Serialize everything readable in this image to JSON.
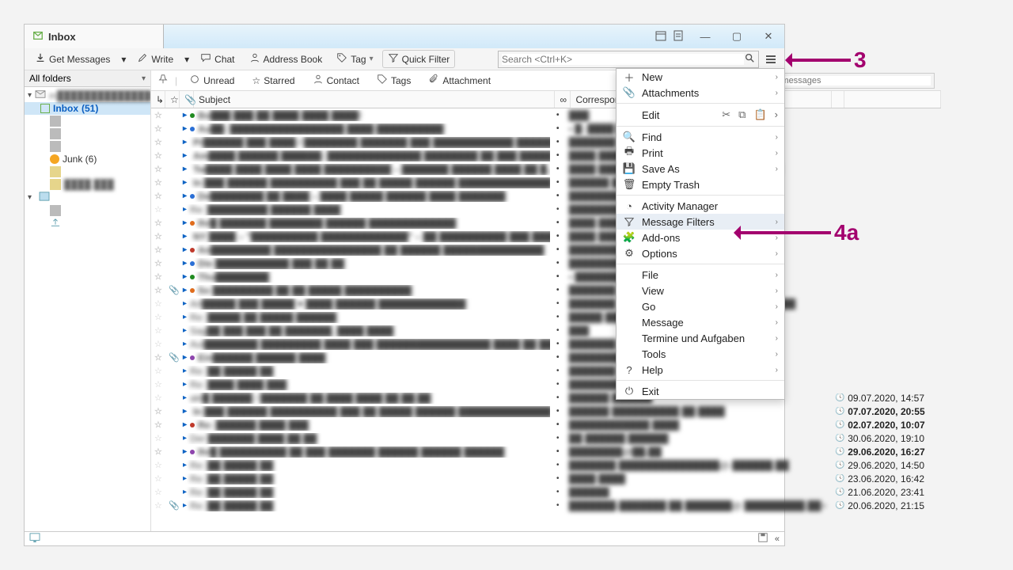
{
  "title": "Inbox",
  "toolbar": {
    "get_messages": "Get Messages",
    "write": "Write",
    "chat": "Chat",
    "address_book": "Address Book",
    "tag": "Tag",
    "quick_filter": "Quick Filter",
    "search_placeholder": "Search <Ctrl+K>"
  },
  "filterbar": {
    "unread": "Unread",
    "starred": "Starred",
    "contact": "Contact",
    "tags": "Tags",
    "attachment": "Attachment",
    "filter_placeholder": "Filter these messages"
  },
  "sidebar": {
    "allfolders": "All folders",
    "account_blur": "m██████████████loud.com",
    "inbox": "Inbox",
    "inbox_count": "(51)",
    "junk": "Junk (6)",
    "blurfolder": "████.███"
  },
  "columns": {
    "subject": "Subject",
    "correspondents": "Correspondents"
  },
  "menu": {
    "new": "New",
    "attachments": "Attachments",
    "edit": "Edit",
    "find": "Find",
    "print": "Print",
    "save_as": "Save As",
    "empty_trash": "Empty Trash",
    "activity_manager": "Activity Manager",
    "message_filters": "Message Filters",
    "addons": "Add-ons",
    "options": "Options",
    "file": "File",
    "view": "View",
    "go": "Go",
    "message": "Message",
    "termine": "Termine und Aufgaben",
    "tools": "Tools",
    "help": "Help",
    "exit": "Exit"
  },
  "annotations": {
    "n3": "3",
    "n4a": "4a"
  },
  "rows": [
    {
      "bold": true,
      "bullet": "#1f8a1f",
      "sub": "Bo███ ███ ██ ████ ████ ████!",
      "corr": "███",
      "date": ""
    },
    {
      "bold": true,
      "bullet": "#2a6fd6",
      "sub": "Au██: █████████████████ ████ ██████████",
      "corr": "• █: ████ ████",
      "date": ""
    },
    {
      "bold": true,
      "bullet": "#e06c1c",
      "sub": "Pr██████ ███ ████ / ████████ ███████ ███ ████████████ █████████████...",
      "corr": "███████ ██████ & ███████",
      "date": ""
    },
    {
      "bold": true,
      "bullet": "#8e44ad",
      "sub": "Am████ ██████ ██████: ██████████████ ████████ ██ ███ █████ ███...",
      "corr": "████ ████ ████████ & ██████████",
      "date": ""
    },
    {
      "bold": true,
      "bullet": "#c0392b",
      "sub": "Tw████ ████ ████ ████ ██████████ – ███████ ██████ ████ ██ █...",
      "corr": "████ ████ ███████ & ██████████████",
      "date": ""
    },
    {
      "bold": true,
      "bullet": "#1f8a1f",
      "sub": "In ███ ██████ ██████████ ███ ██ █████ ██████ ██████████████ ██████.",
      "corr": "██████ ██████ ██████ ██ ████",
      "date": ""
    },
    {
      "bold": true,
      "bullet": "#2a6fd6",
      "sub": "De████████ ██ ████ – ████ █████ ██████ ████ ███████",
      "corr": "███████████████",
      "date": ""
    },
    {
      "bold": false,
      "bullet": "",
      "sub": "Re: █████████ ██████ ████",
      "corr": "█████████ ██████",
      "date": ""
    },
    {
      "bold": true,
      "bullet": "#e06c1c",
      "sub": "Ihr█ ███████ ████████ ██████ █████████████",
      "corr": "████ █████",
      "date": ""
    },
    {
      "bold": true,
      "bullet": "#8e44ad",
      "sub": "NY ████ – \"██████████ █████████████\" – ██ ██████████ ███ ██████████...",
      "corr": "████ ████ ██████",
      "date": ""
    },
    {
      "bold": true,
      "bullet": "#c0392b",
      "sub": "An█████████ ████████████████ ██ ██████ ███████████████",
      "corr": "█████████████ ████.████████.██",
      "date": ""
    },
    {
      "bold": true,
      "bullet": "#2a6fd6",
      "sub": "Die ███████████ ███ ██ ██",
      "corr": "███████████-████████████████",
      "date": ""
    },
    {
      "bold": true,
      "bullet": "#1f8a1f",
      "sub": "Thu████████",
      "corr": "• ██████████████@██████.███",
      "date": ""
    },
    {
      "bold": true,
      "attach": true,
      "bullet": "#e06c1c",
      "sub": "So █████████ ██ ██ █████ ██████████",
      "corr": "███████ ████",
      "date": ""
    },
    {
      "bold": false,
      "bullet": "",
      "sub": "Art█████ ███ █████ ♥ ████ ██████ █████████████",
      "corr": "███████ & ██████ – ███ ██████████████",
      "date": ""
    },
    {
      "bold": false,
      "bullet": "",
      "sub": "Re: █████ ██ █████ ██████",
      "corr": "█████ ███████",
      "date": ""
    },
    {
      "bold": false,
      "bullet": "",
      "sub": "Sag██ ███ ███ ██ ███████, ████ ████",
      "corr": "███",
      "date": ""
    },
    {
      "bold": false,
      "bullet": "",
      "sub": "Aut████████ █████████ ████ ███ █████████████████ ████ ██ ████ █████...",
      "corr": "███████.██████████@███████.███",
      "date": ""
    },
    {
      "bold": true,
      "attach": true,
      "bullet": "#8e44ad",
      "sub": "Ein██████ ██████ ████",
      "corr": "█████████.████████ ██@██.██",
      "date": ""
    },
    {
      "bold": false,
      "bullet": "",
      "sub": "Re: ██ █████ ██",
      "corr": "███████ ██████",
      "date": ""
    },
    {
      "bold": false,
      "bullet": "",
      "sub": "Re: ████ ████ ███",
      "corr": "█████████ ██████",
      "date": ""
    },
    {
      "bold": false,
      "bullet": "",
      "sub": "akt█ ██████ / ███████ ██.████ ████ ██:██.██",
      "corr": "██████ ██████",
      "date": "09.07.2020, 14:57"
    },
    {
      "bold": true,
      "bullet": "#1f8a1f",
      "sub": "In ███ ██████ ██████████ ███ ██ █████ ██████ ██████████████ ██████.",
      "corr": "██████ ██████████ ██ ████",
      "date": "07.07.2020, 20:55"
    },
    {
      "bold": true,
      "bullet": "#c0392b",
      "sub": "Re: ██████ ████ ███",
      "corr": "████████████ ████",
      "date": "02.07.2020, 10:07"
    },
    {
      "bold": false,
      "bullet": "",
      "sub": "Der ███████ ████ ██ ██",
      "corr": "██ ██████ ██████",
      "date": "30.06.2020, 19:10"
    },
    {
      "bold": true,
      "bullet": "#8e44ad",
      "sub": "Ihr█ ██████████ ██ ███ ███████ ██████ ██████ ██████",
      "corr": "████████@██.██",
      "date": "29.06.2020, 16:27"
    },
    {
      "bold": false,
      "bullet": "",
      "sub": "Re: ██ █████ ██",
      "corr": "███████ ███████████████@-██████.██",
      "date": "29.06.2020, 14:50"
    },
    {
      "bold": false,
      "bullet": "",
      "sub": "Re: ██ █████ ██",
      "corr": "████ ████",
      "date": "23.06.2020, 16:42"
    },
    {
      "bold": false,
      "bullet": "",
      "sub": "Re: ██ █████ ██",
      "corr": "██████",
      "date": "21.06.2020, 23:41"
    },
    {
      "bold": false,
      "attach": true,
      "bullet": "",
      "sub": "Re: ██ █████ ██",
      "corr": "███████-███████ ██ ███████@ █████████.██>",
      "date": "20.06.2020, 21:15"
    }
  ]
}
